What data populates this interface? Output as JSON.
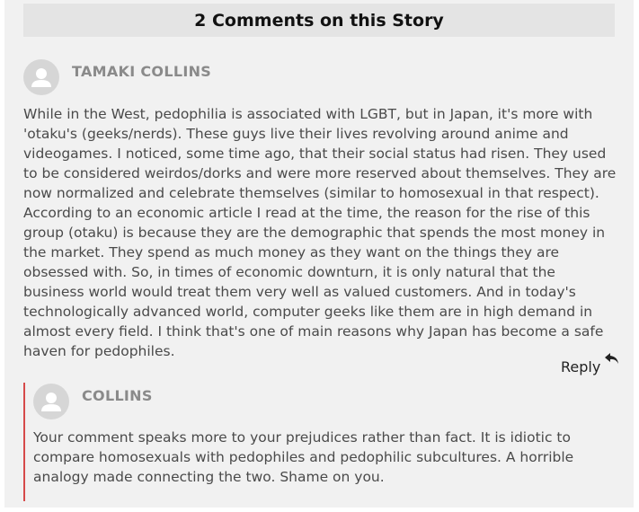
{
  "header": {
    "title": "2 Comments on this Story"
  },
  "comments": [
    {
      "author": "TAMAKI COLLINS",
      "text": "While in the West, pedophilia is associated with LGBT, but in Japan, it's more with 'otaku's (geeks/nerds). These guys live their lives revolving around anime and videogames. I noticed, some time ago, that their social status had risen. They used to be considered weirdos/dorks and were more reserved about themselves. They are now normalized and celebrate themselves (similar to homosexual in that respect). According to an economic article I read at the time, the reason for the rise of this group (otaku) is because they are the demographic that spends the most money in the market. They spend as much money as they want on the things they are obsessed with. So, in times of economic downturn, it is only natural that the business world would treat them very well as valued customers. And in today's technologically advanced world, computer geeks like them are in high demand in almost every field. I think that's one of main reasons why Japan has become a safe haven for pedophiles.",
      "reply_label": "Reply"
    },
    {
      "author": "COLLINS",
      "text": "Your comment speaks more to your prejudices rather than fact. It is idiotic to compare homosexuals with pedophiles and pedophilic subcultures. A horrible analogy made connecting the two. Shame on you."
    }
  ],
  "colors": {
    "reply_accent": "#d64a4a",
    "author": "#8a8a8a"
  },
  "icons": {
    "avatar": "user-avatar-icon",
    "reply": "reply-arrow-icon"
  }
}
